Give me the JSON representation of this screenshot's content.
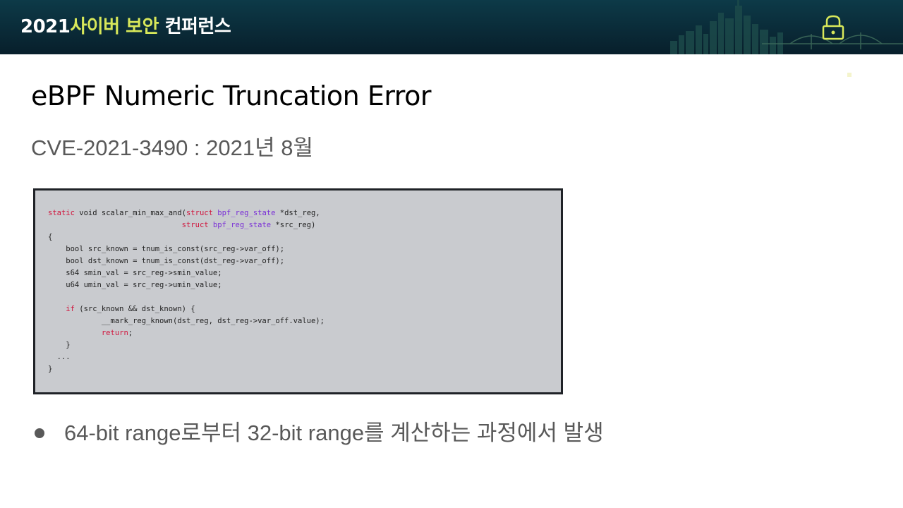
{
  "header": {
    "year": "2021",
    "accent": "사이버 보안",
    "rest": " 컨퍼런스",
    "icon": "lock-icon"
  },
  "slide": {
    "title": "eBPF Numeric Truncation Error",
    "subtitle": "CVE-2021-3490 : 2021년 8월",
    "code": {
      "line1_kw": "static",
      "line1_rest": " void scalar_min_max_and(",
      "line1_struct": "struct",
      "line1_type": " bpf_reg_state",
      "line1_end": " *dst_reg,",
      "line2_pad": "                              ",
      "line2_struct": "struct",
      "line2_type": " bpf_reg_state",
      "line2_end": " *src_reg)",
      "line3": "{",
      "line4": "    bool src_known = tnum_is_const(src_reg->var_off);",
      "line5": "    bool dst_known = tnum_is_const(dst_reg->var_off);",
      "line6": "    s64 smin_val = src_reg->smin_value;",
      "line7": "    u64 umin_val = src_reg->umin_value;",
      "line9_pad": "    ",
      "line9_kw": "if",
      "line9_rest": " (src_known && dst_known) {",
      "line10": "            __mark_reg_known(dst_reg, dst_reg->var_off.value);",
      "line11_pad": "            ",
      "line11_kw": "return",
      "line11_rest": ";",
      "line12": "    }",
      "line13": "  ...",
      "line14": "}"
    },
    "bullet": "64-bit range로부터 32-bit range를 계산하는 과정에서 발생"
  },
  "colors": {
    "header_bg": "#0a2b38",
    "accent": "#d8e85a",
    "keyword": "#d0143c",
    "type": "#7a2fd6",
    "code_bg": "#c9cbcf"
  }
}
